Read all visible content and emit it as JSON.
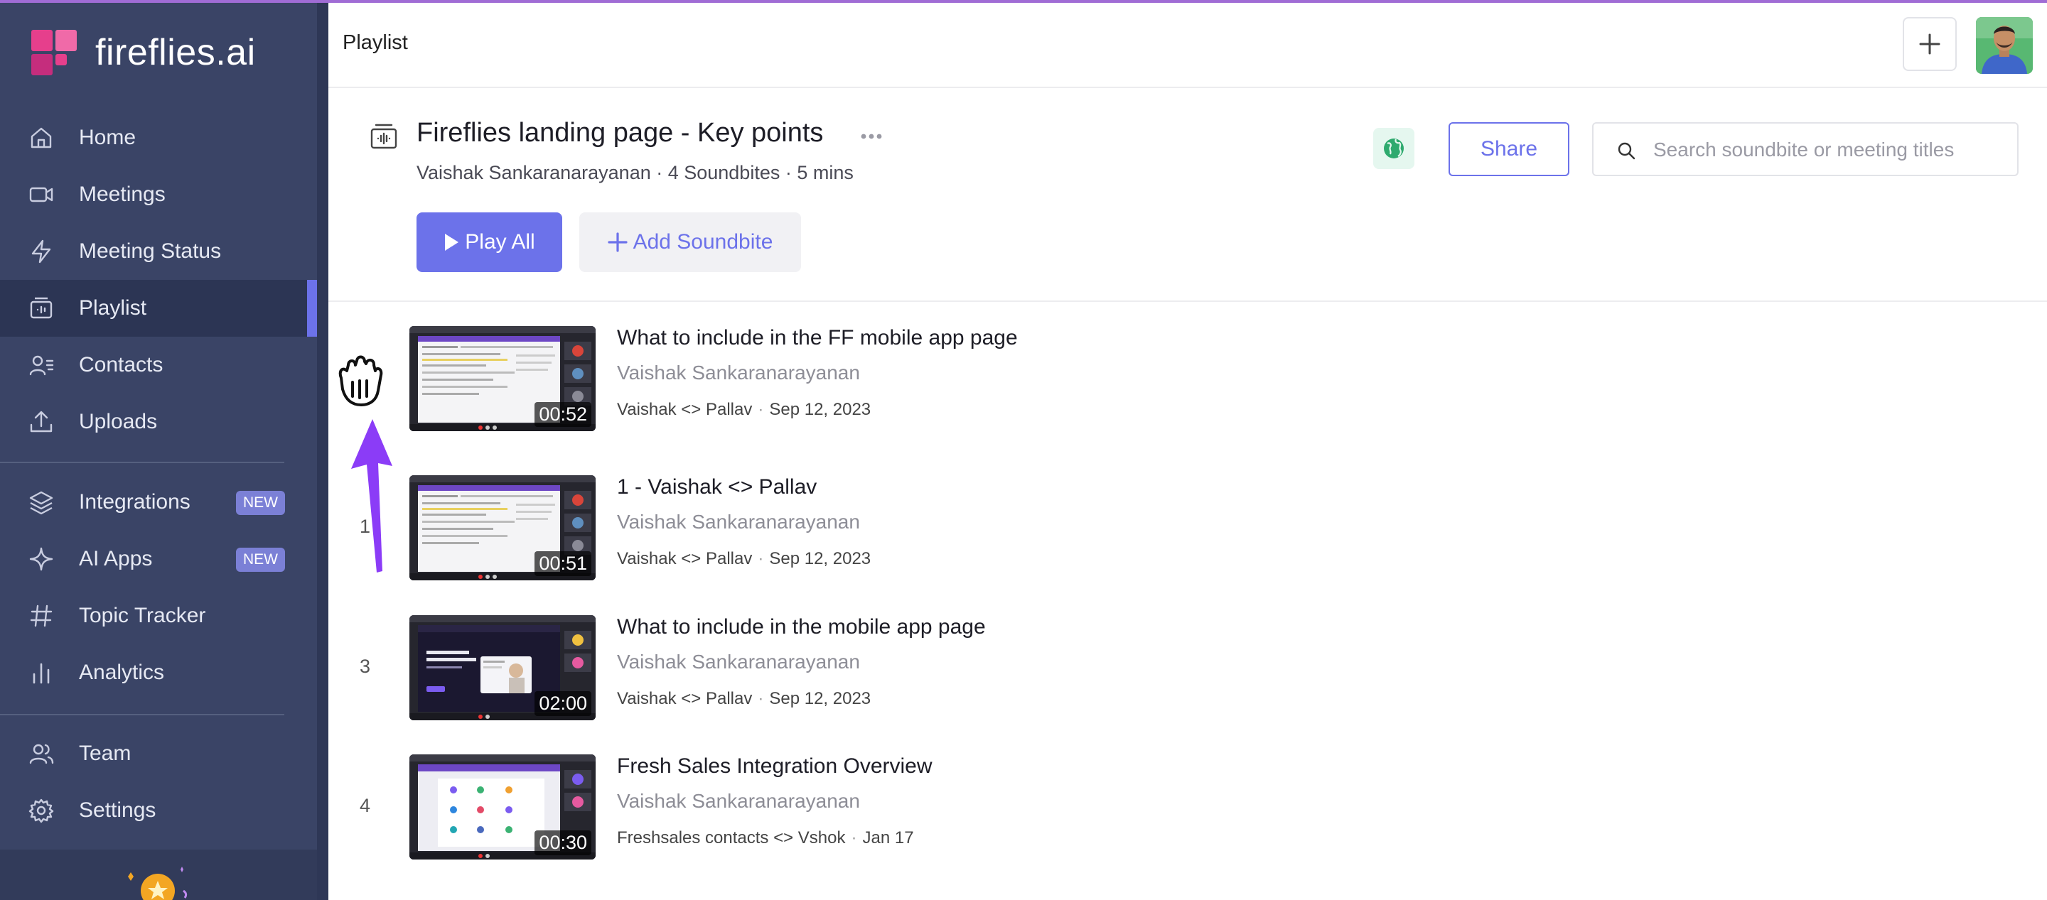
{
  "brand": {
    "name": "fireflies.ai"
  },
  "sidebar": {
    "items": [
      {
        "label": "Home",
        "icon": "home-icon"
      },
      {
        "label": "Meetings",
        "icon": "video-icon"
      },
      {
        "label": "Meeting Status",
        "icon": "bolt-icon"
      },
      {
        "label": "Playlist",
        "icon": "playlist-icon",
        "active": true
      },
      {
        "label": "Contacts",
        "icon": "contacts-icon"
      },
      {
        "label": "Uploads",
        "icon": "upload-icon"
      },
      {
        "label": "Integrations",
        "icon": "layers-icon",
        "badge": "NEW"
      },
      {
        "label": "AI Apps",
        "icon": "sparkle-icon",
        "badge": "NEW"
      },
      {
        "label": "Topic Tracker",
        "icon": "hash-icon"
      },
      {
        "label": "Analytics",
        "icon": "bar-chart-icon"
      },
      {
        "label": "Team",
        "icon": "team-icon"
      },
      {
        "label": "Settings",
        "icon": "gear-icon"
      }
    ]
  },
  "topbar": {
    "title": "Playlist"
  },
  "playlist": {
    "title": "Fireflies landing page - Key points",
    "meta": "Vaishak Sankaranarayanan · 4 Soundbites · 5 mins",
    "share_label": "Share",
    "search_placeholder": "Search soundbite or meeting titles",
    "play_all_label": "Play All",
    "add_soundbite_label": "Add Soundbite"
  },
  "soundbites": [
    {
      "number": "",
      "title": "What to include in the FF mobile app page",
      "owner": "Vaishak Sankaranarayanan",
      "meeting": "Vaishak <> Pallav",
      "date": "Sep 12, 2023",
      "duration": "00:52"
    },
    {
      "number": "1",
      "title": "1 - Vaishak <> Pallav",
      "owner": "Vaishak Sankaranarayanan",
      "meeting": "Vaishak <> Pallav",
      "date": "Sep 12, 2023",
      "duration": "00:51"
    },
    {
      "number": "3",
      "title": "What to include in the mobile app page",
      "owner": "Vaishak Sankaranarayanan",
      "meeting": "Vaishak <> Pallav",
      "date": "Sep 12, 2023",
      "duration": "02:00"
    },
    {
      "number": "4",
      "title": "Fresh Sales Integration Overview",
      "owner": "Vaishak Sankaranarayanan",
      "meeting": "Freshsales contacts <> Vshok",
      "date": "Jan 17",
      "duration": "00:30"
    }
  ],
  "colors": {
    "sidebar": "#3a4466",
    "accent": "#6c72ea",
    "arrow": "#8b3cf7"
  }
}
